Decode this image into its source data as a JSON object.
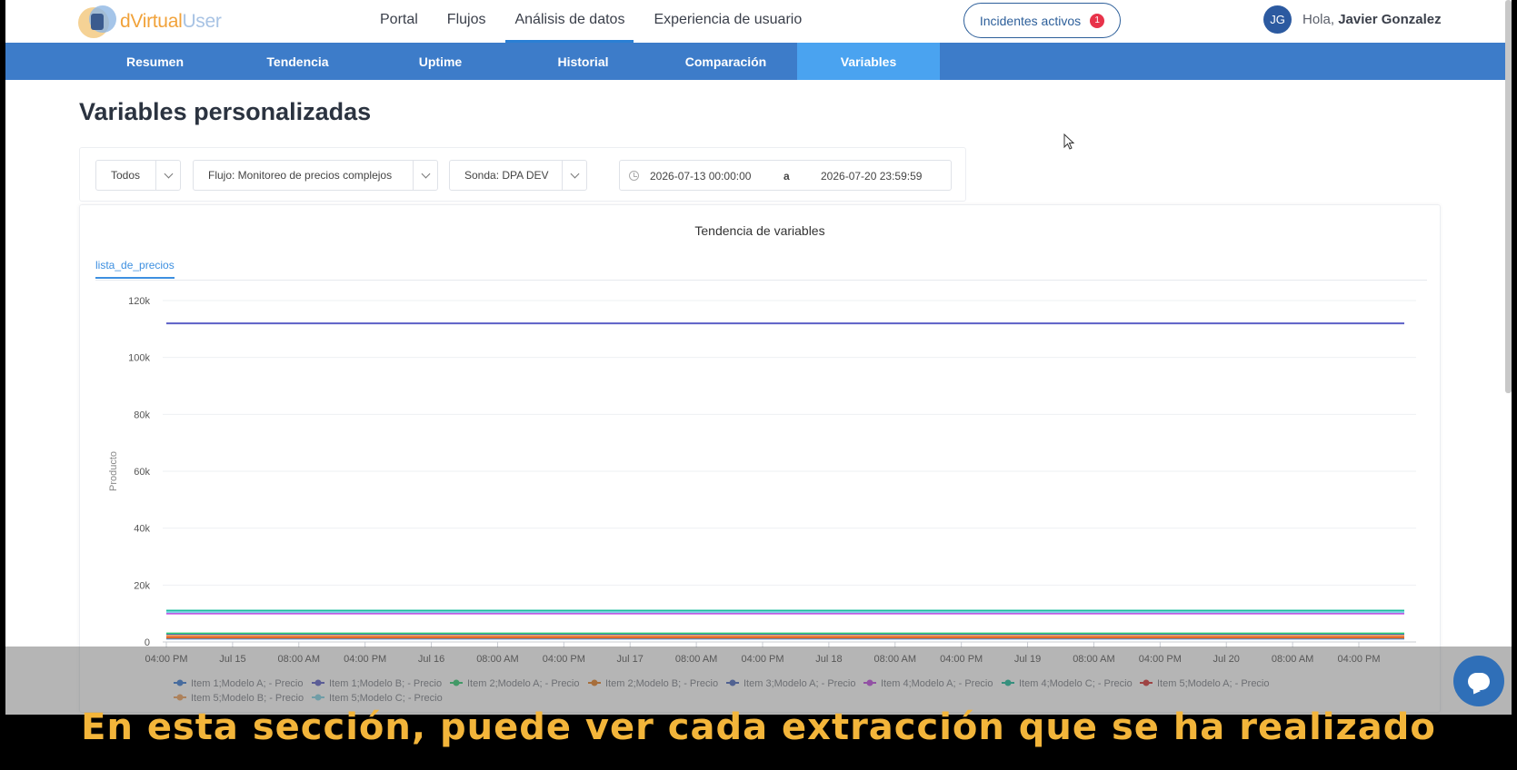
{
  "header": {
    "brand_prefix": "d",
    "brand_main": "Virtual",
    "brand_suffix": "User",
    "nav": [
      {
        "label": "Portal",
        "active": false
      },
      {
        "label": "Flujos",
        "active": false
      },
      {
        "label": "Análisis de datos",
        "active": true
      },
      {
        "label": "Experiencia de usuario",
        "active": false
      }
    ],
    "incidents_label": "Incidentes activos",
    "incidents_count": "1",
    "user_initials": "JG",
    "greeting": "Hola,",
    "user_name": "Javier Gonzalez"
  },
  "subnav": {
    "tabs": [
      {
        "label": "Resumen",
        "active": false
      },
      {
        "label": "Tendencia",
        "active": false
      },
      {
        "label": "Uptime",
        "active": false
      },
      {
        "label": "Historial",
        "active": false
      },
      {
        "label": "Comparación",
        "active": false
      },
      {
        "label": "Variables",
        "active": true
      }
    ]
  },
  "page": {
    "title": "Variables personalizadas"
  },
  "filters": {
    "scope": "Todos",
    "flow": "Flujo: Monitoreo de precios complejos",
    "probe": "Sonda: DPA DEV",
    "date_from": "2026-07-13 00:00:00",
    "date_sep": "a",
    "date_to": "2026-07-20 23:59:59"
  },
  "chart_tab": "lista_de_precios",
  "chart_data": {
    "type": "line",
    "title": "Tendencia de variables",
    "ylabel": "Producto",
    "ylim": [
      0,
      120000
    ],
    "yticks": [
      0,
      20000,
      40000,
      60000,
      80000,
      100000,
      120000
    ],
    "ytick_labels": [
      "0",
      "20k",
      "40k",
      "60k",
      "80k",
      "100k",
      "120k"
    ],
    "xtick_labels": [
      "04:00 PM",
      "Jul 15",
      "08:00 AM",
      "04:00 PM",
      "Jul 16",
      "08:00 AM",
      "04:00 PM",
      "Jul 17",
      "08:00 AM",
      "04:00 PM",
      "Jul 18",
      "08:00 AM",
      "04:00 PM",
      "Jul 19",
      "08:00 AM",
      "04:00 PM",
      "Jul 20",
      "08:00 AM",
      "04:00 PM"
    ],
    "grid": true,
    "legend_placement": "bottom",
    "series": [
      {
        "name": "Item 1;Modelo A; - Precio",
        "color": "#3a7bd5",
        "values": [
          1200,
          1200
        ]
      },
      {
        "name": "Item 1;Modelo B; - Precio",
        "color": "#5b5fc7",
        "values": [
          112000,
          112000
        ]
      },
      {
        "name": "Item 2;Modelo A; - Precio",
        "color": "#2ecc71",
        "values": [
          3000,
          3000
        ]
      },
      {
        "name": "Item 2;Modelo B; - Precio",
        "color": "#e67e22",
        "values": [
          1500,
          1500
        ]
      },
      {
        "name": "Item 3;Modelo A; - Precio",
        "color": "#4a69bd",
        "values": [
          2500,
          2500
        ]
      },
      {
        "name": "Item 4;Modelo A; - Precio",
        "color": "#c04ae0",
        "values": [
          10000,
          10000
        ]
      },
      {
        "name": "Item 4;Modelo C; - Precio",
        "color": "#1abc9c",
        "values": [
          11000,
          11000
        ]
      },
      {
        "name": "Item 5;Modelo A; - Precio",
        "color": "#d63031",
        "values": [
          2000,
          2000
        ]
      },
      {
        "name": "Item 5;Modelo B; - Precio",
        "color": "#f0a35e",
        "values": [
          2200,
          2200
        ]
      },
      {
        "name": "Item 5;Modelo C; - Precio",
        "color": "#81d4e6",
        "values": [
          10500,
          10500
        ]
      }
    ]
  },
  "caption": "En esta sección, puede ver cada extracción que se ha realizado"
}
